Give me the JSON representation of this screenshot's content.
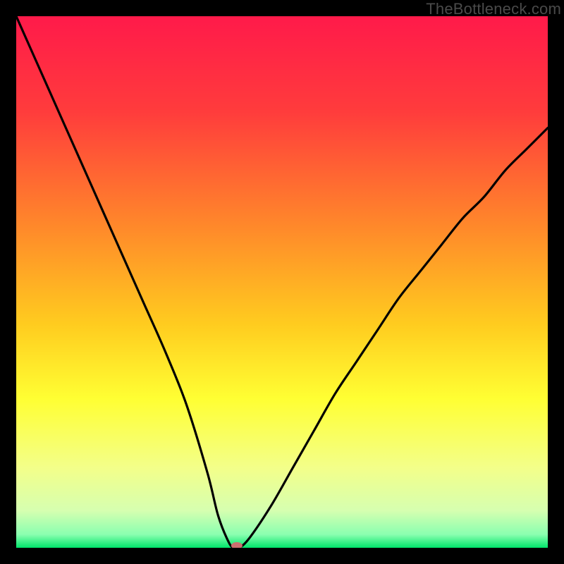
{
  "watermark": "TheBottleneck.com",
  "chart_data": {
    "type": "line",
    "title": "",
    "xlabel": "",
    "ylabel": "",
    "xlim": [
      0,
      100
    ],
    "ylim": [
      0,
      100
    ],
    "grid": false,
    "legend": false,
    "gradient_stops": [
      {
        "offset": 0,
        "color": "#ff1a4a"
      },
      {
        "offset": 0.18,
        "color": "#ff3c3c"
      },
      {
        "offset": 0.4,
        "color": "#ff8a2a"
      },
      {
        "offset": 0.58,
        "color": "#ffcc1f"
      },
      {
        "offset": 0.72,
        "color": "#ffff33"
      },
      {
        "offset": 0.85,
        "color": "#f3ff8a"
      },
      {
        "offset": 0.93,
        "color": "#d6ffb0"
      },
      {
        "offset": 0.975,
        "color": "#8affb0"
      },
      {
        "offset": 1.0,
        "color": "#00e46a"
      }
    ],
    "series": [
      {
        "name": "bottleneck-curve",
        "x": [
          0,
          4,
          8,
          12,
          16,
          20,
          24,
          28,
          32,
          36,
          38,
          40,
          41,
          42,
          44,
          48,
          52,
          56,
          60,
          64,
          68,
          72,
          76,
          80,
          84,
          88,
          92,
          96,
          100
        ],
        "y": [
          100,
          91,
          82,
          73,
          64,
          55,
          46,
          37,
          27,
          14,
          6,
          1,
          0,
          0,
          2,
          8,
          15,
          22,
          29,
          35,
          41,
          47,
          52,
          57,
          62,
          66,
          71,
          75,
          79
        ]
      }
    ],
    "minimum_marker": {
      "x": 41.5,
      "y": 0,
      "color": "#cc6f6f",
      "rx": 8,
      "ry": 5
    }
  }
}
